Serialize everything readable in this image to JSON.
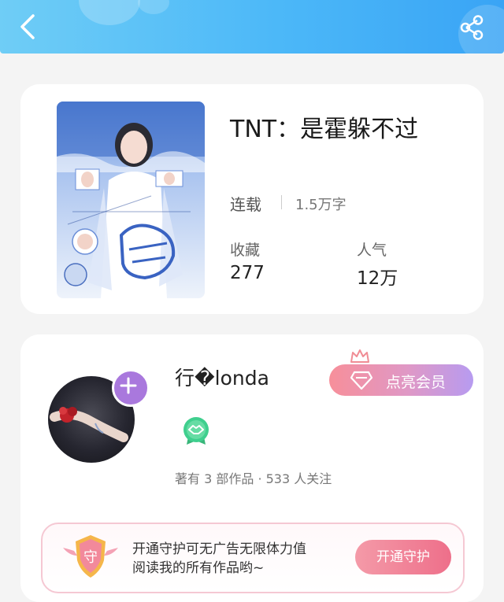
{
  "header": {
    "back_icon": "chevron-left-icon",
    "share_icon": "share-icon",
    "gradient_colors": [
      "#6fcdf6",
      "#39a4f5"
    ]
  },
  "book": {
    "title": "TNT：是霍躲不过",
    "status": "连载",
    "word_count": "1.5万字",
    "stats": [
      {
        "label": "收藏",
        "value": "277"
      },
      {
        "label": "人气",
        "value": "12万"
      }
    ]
  },
  "author": {
    "name": "行�londa",
    "vip_button_label": "点亮会员",
    "stats_text": "著有 3 部作品 · 533 人关注",
    "badge_icon": "handshake-badge-icon",
    "follow_icon": "plus-icon"
  },
  "guard": {
    "icon_char": "守",
    "line1": "开通守护可无广告无限体力值",
    "line2": "阅读我的所有作品哟~",
    "button_label": "开通守护"
  },
  "colors": {
    "accent_purple": "#a978dd",
    "vip_gradient": [
      "#f78f9a",
      "#b79bf0"
    ],
    "guard_button": "#ee6f8a",
    "badge_green": "#3fcf8e"
  }
}
